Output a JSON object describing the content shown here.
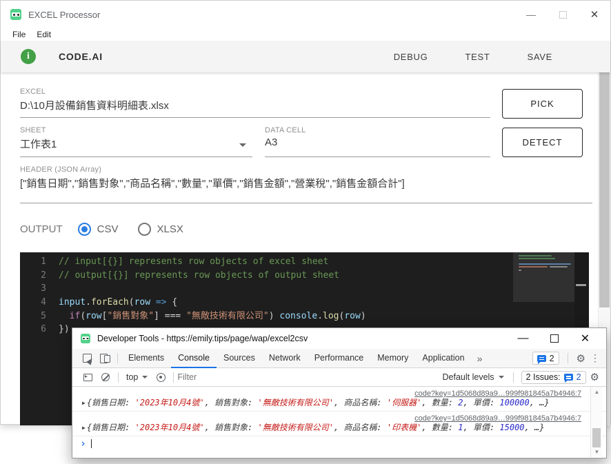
{
  "app": {
    "window_title": "EXCEL Processor",
    "menu": {
      "file": "File",
      "edit": "Edit"
    },
    "brand": "CODE.AI",
    "actions": [
      "DEBUG",
      "TEST",
      "SAVE"
    ],
    "fields": {
      "excel": {
        "label": "EXCEL",
        "value": "D:\\10月設備銷售資料明細表.xlsx"
      },
      "sheet": {
        "label": "SHEET",
        "value": "工作表1"
      },
      "data_cell": {
        "label": "DATA CELL",
        "value": "A3"
      },
      "header": {
        "label": "HEADER (JSON Array)",
        "value": "[\"銷售日期\",\"銷售對象\",\"商品名稱\",\"數量\",\"單價\",\"銷售金額\",\"營業稅\",\"銷售金額合計\"]"
      }
    },
    "buttons": {
      "pick": "PICK",
      "detect": "DETECT"
    },
    "output": {
      "label": "OUTPUT",
      "options": [
        {
          "label": "CSV",
          "selected": true
        },
        {
          "label": "XLSX",
          "selected": false
        }
      ]
    },
    "editor": {
      "lines": [
        [
          {
            "c": "cm",
            "t": "// input[{}] represents row objects of excel sheet"
          }
        ],
        [
          {
            "c": "cm",
            "t": "// output[{}] represents row objects of output sheet"
          }
        ],
        [],
        [
          {
            "c": "var",
            "t": "input"
          },
          {
            "c": "pun",
            "t": "."
          },
          {
            "c": "fn",
            "t": "forEach"
          },
          {
            "c": "pun",
            "t": "("
          },
          {
            "c": "var",
            "t": "row"
          },
          {
            "c": "pun",
            "t": " "
          },
          {
            "c": "op",
            "t": "=>"
          },
          {
            "c": "pun",
            "t": " {"
          }
        ],
        [
          {
            "c": "pun",
            "t": "  "
          },
          {
            "c": "kw",
            "t": "if"
          },
          {
            "c": "pun",
            "t": "("
          },
          {
            "c": "var",
            "t": "row"
          },
          {
            "c": "pun",
            "t": "["
          },
          {
            "c": "str",
            "t": "\"銷售對象\""
          },
          {
            "c": "pun",
            "t": "] === "
          },
          {
            "c": "str",
            "t": "\"無敵技術有限公司\""
          },
          {
            "c": "pun",
            "t": ") "
          },
          {
            "c": "var",
            "t": "console"
          },
          {
            "c": "pun",
            "t": "."
          },
          {
            "c": "fn",
            "t": "log"
          },
          {
            "c": "pun",
            "t": "("
          },
          {
            "c": "var",
            "t": "row"
          },
          {
            "c": "pun",
            "t": ")"
          }
        ],
        [
          {
            "c": "pun",
            "t": "})"
          }
        ]
      ]
    },
    "colors": {
      "accent_green": "#43a047",
      "radio_blue": "#2a7de1",
      "editor_bg": "#1e1e1e"
    }
  },
  "devtools": {
    "window_title": "Developer Tools - https://emily.tips/page/wap/excel2csv",
    "tabs": [
      "Elements",
      "Console",
      "Sources",
      "Network",
      "Performance",
      "Memory",
      "Application"
    ],
    "active_tab": "Console",
    "more_tabs_glyph": "»",
    "badge_count": "2",
    "toolbar": {
      "context": "top",
      "filter_placeholder": "Filter",
      "levels": "Default levels",
      "issues_label": "2 Issues:",
      "issues_count": "2"
    },
    "console": {
      "entries": [
        {
          "link": "code?key=1d5068d89a9…999f981845a7b4946:7",
          "tokens": [
            {
              "c": "p",
              "t": "{"
            },
            {
              "c": "k",
              "t": "銷售日期"
            },
            {
              "c": "p",
              "t": ": "
            },
            {
              "c": "s",
              "t": "'2023年10月4號'"
            },
            {
              "c": "p",
              "t": ", "
            },
            {
              "c": "k",
              "t": "銷售對象"
            },
            {
              "c": "p",
              "t": ": "
            },
            {
              "c": "s",
              "t": "'無敵技術有限公司'"
            },
            {
              "c": "p",
              "t": ", "
            },
            {
              "c": "k",
              "t": "商品名稱"
            },
            {
              "c": "p",
              "t": ": "
            },
            {
              "c": "s",
              "t": "'伺服器'"
            },
            {
              "c": "p",
              "t": ", "
            },
            {
              "c": "k",
              "t": "數量"
            },
            {
              "c": "p",
              "t": ": "
            },
            {
              "c": "n",
              "t": "2"
            },
            {
              "c": "p",
              "t": ", "
            },
            {
              "c": "k",
              "t": "單價"
            },
            {
              "c": "p",
              "t": ": "
            },
            {
              "c": "n",
              "t": "100000"
            },
            {
              "c": "p",
              "t": ", …}"
            }
          ]
        },
        {
          "link": "code?key=1d5068d89a9…999f981845a7b4946:7",
          "tokens": [
            {
              "c": "p",
              "t": "{"
            },
            {
              "c": "k",
              "t": "銷售日期"
            },
            {
              "c": "p",
              "t": ": "
            },
            {
              "c": "s",
              "t": "'2023年10月4號'"
            },
            {
              "c": "p",
              "t": ", "
            },
            {
              "c": "k",
              "t": "銷售對象"
            },
            {
              "c": "p",
              "t": ": "
            },
            {
              "c": "s",
              "t": "'無敵技術有限公司'"
            },
            {
              "c": "p",
              "t": ", "
            },
            {
              "c": "k",
              "t": "商品名稱"
            },
            {
              "c": "p",
              "t": ": "
            },
            {
              "c": "s",
              "t": "'印表機'"
            },
            {
              "c": "p",
              "t": ", "
            },
            {
              "c": "k",
              "t": "數量"
            },
            {
              "c": "p",
              "t": ": "
            },
            {
              "c": "n",
              "t": "1"
            },
            {
              "c": "p",
              "t": ", "
            },
            {
              "c": "k",
              "t": "單價"
            },
            {
              "c": "p",
              "t": ": "
            },
            {
              "c": "n",
              "t": "15000"
            },
            {
              "c": "p",
              "t": ", …}"
            }
          ]
        }
      ],
      "prompt_glyph": "›"
    },
    "colors": {
      "tab_accent": "#1a73e8",
      "string_red": "#c41a16",
      "number_blue": "#2727c8"
    }
  },
  "glyphs": {
    "minimize": "—",
    "close": "✕",
    "gear": "⚙",
    "kebab": "⋮",
    "scroll_up": "▲",
    "scroll_down": "▼",
    "expander": "▶"
  }
}
